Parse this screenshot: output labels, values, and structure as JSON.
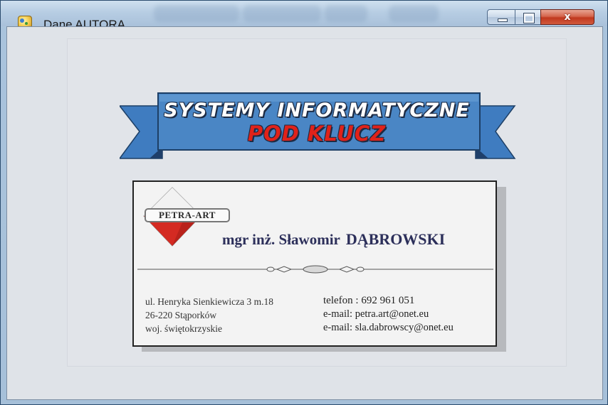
{
  "window": {
    "title": "Dane AUTORA",
    "controls": {
      "minimize": "minimize",
      "maximize": "maximize",
      "close": "x"
    }
  },
  "banner": {
    "line1": "SYSTEMY INFORMATYCZNE",
    "line2": "POD KLUCZ",
    "ribbon_color": "#4a86c5",
    "line2_color": "#e0221a"
  },
  "card": {
    "logo_text": "PETRA-ART",
    "person_prefix": "mgr inż. Sławomir",
    "person_surname": "DĄBROWSKI",
    "address": [
      "ul. Henryka Sienkiewicza 3 m.18",
      "26-220 Stąporków",
      "woj. świętokrzyskie"
    ],
    "contact": [
      "telefon :  692 961 051",
      "e-mail: petra.art@onet.eu",
      "e-mail: sla.dabrowscy@onet.eu"
    ]
  },
  "icons": {
    "app": "app-icon",
    "minimize": "minimize-icon",
    "maximize": "maximize-icon",
    "close": "close-icon",
    "logo": "diamond-logo-icon"
  }
}
